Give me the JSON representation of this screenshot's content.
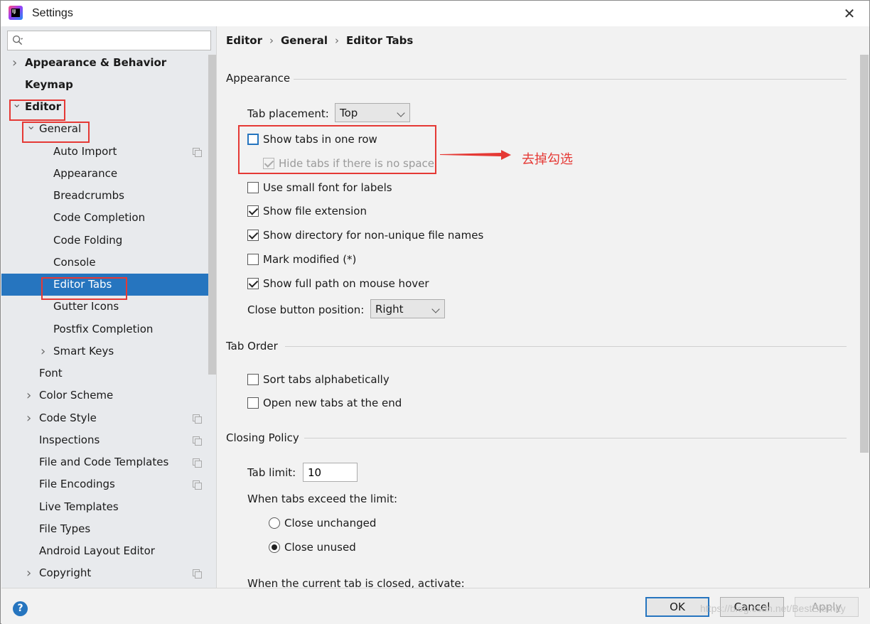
{
  "window": {
    "title": "Settings"
  },
  "search": {
    "value": "",
    "placeholder": ""
  },
  "tree": [
    {
      "label": "Appearance & Behavior",
      "chevron": "right"
    },
    {
      "label": "Keymap"
    },
    {
      "label": "Editor",
      "chevron": "down"
    },
    {
      "label": "General",
      "chevron": "down"
    },
    {
      "label": "Auto Import",
      "icon": "copy-icon"
    },
    {
      "label": "Appearance"
    },
    {
      "label": "Breadcrumbs"
    },
    {
      "label": "Code Completion"
    },
    {
      "label": "Code Folding"
    },
    {
      "label": "Console"
    },
    {
      "label": "Editor Tabs",
      "selected": true
    },
    {
      "label": "Gutter Icons"
    },
    {
      "label": "Postfix Completion"
    },
    {
      "label": "Smart Keys",
      "chevron": "right"
    },
    {
      "label": "Font"
    },
    {
      "label": "Color Scheme",
      "chevron": "right"
    },
    {
      "label": "Code Style",
      "chevron": "right",
      "icon": "copy-icon"
    },
    {
      "label": "Inspections",
      "icon": "copy-icon"
    },
    {
      "label": "File and Code Templates",
      "icon": "copy-icon"
    },
    {
      "label": "File Encodings",
      "icon": "copy-icon"
    },
    {
      "label": "Live Templates"
    },
    {
      "label": "File Types"
    },
    {
      "label": "Android Layout Editor"
    },
    {
      "label": "Copyright",
      "chevron": "right",
      "icon": "copy-icon"
    }
  ],
  "breadcrumb": {
    "items": [
      "Editor",
      "General",
      "Editor Tabs"
    ],
    "separator": "›"
  },
  "appearance": {
    "section_title": "Appearance",
    "tab_placement_label": "Tab placement:",
    "tab_placement_value": "Top",
    "show_tabs_one_row": {
      "label": "Show tabs in one row",
      "checked": false
    },
    "hide_tabs_no_space": {
      "label": "Hide tabs if there is no space",
      "checked": true,
      "disabled": true
    },
    "small_font": {
      "label": "Use small font for labels",
      "checked": false
    },
    "show_ext": {
      "label": "Show file extension",
      "checked": true
    },
    "show_dir": {
      "label": "Show directory for non-unique file names",
      "checked": true
    },
    "mark_modified": {
      "label": "Mark modified (*)",
      "checked": false
    },
    "full_path": {
      "label": "Show full path on mouse hover",
      "checked": true
    },
    "close_button_label": "Close button position:",
    "close_button_value": "Right"
  },
  "tab_order": {
    "section_title": "Tab Order",
    "sort_alpha": {
      "label": "Sort tabs alphabetically",
      "checked": false
    },
    "open_at_end": {
      "label": "Open new tabs at the end",
      "checked": false
    }
  },
  "closing_policy": {
    "section_title": "Closing Policy",
    "tab_limit_label": "Tab limit:",
    "tab_limit_value": "10",
    "exceed_label": "When tabs exceed the limit:",
    "close_unchanged": {
      "label": "Close unchanged",
      "selected": false
    },
    "close_unused": {
      "label": "Close unused",
      "selected": true
    },
    "activate_label": "When the current tab is closed, activate:"
  },
  "annotation": {
    "text": "去掉勾选",
    "color": "#e53935"
  },
  "footer": {
    "help_symbol": "?",
    "ok_label": "OK",
    "cancel_label": "Cancel",
    "apply_label": "Apply",
    "watermark": "https://blog.csdn.net/BestEternity"
  },
  "colors": {
    "selection": "#2675bf",
    "highlight_box": "#e53935",
    "pane_bg": "#f2f2f2",
    "tree_bg": "#e8eaed"
  }
}
